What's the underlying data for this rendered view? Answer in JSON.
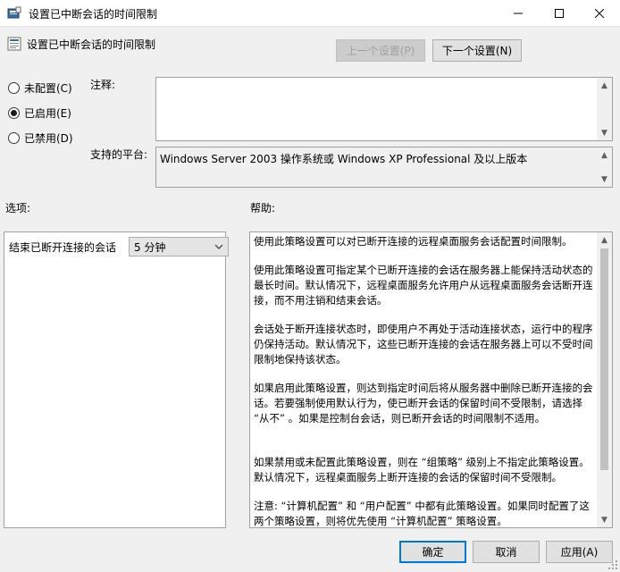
{
  "window": {
    "title": "设置已中断会话的时间限制"
  },
  "header": {
    "title": "设置已中断会话的时间限制",
    "prev_label": "上一个设置(P)",
    "next_label": "下一个设置(N)"
  },
  "state": {
    "options": [
      {
        "label": "未配置(C)",
        "selected": false
      },
      {
        "label": "已启用(E)",
        "selected": true
      },
      {
        "label": "已禁用(D)",
        "selected": false
      }
    ]
  },
  "comment": {
    "label": "注释:",
    "value": ""
  },
  "platform": {
    "label": "支持的平台:",
    "value": "Windows Server 2003 操作系统或 Windows XP Professional 及以上版本"
  },
  "options_section": {
    "label": "选项:",
    "field_label": "结束已断开连接的会话",
    "field_value": "5 分钟"
  },
  "help": {
    "label": "帮助:",
    "paragraphs": [
      "使用此策略设置可以对已断开连接的远程桌面服务会话配置时间限制。",
      "使用此策略设置可指定某个已断开连接的会话在服务器上能保持活动状态的最长时间。默认情况下，远程桌面服务允许用户从远程桌面服务会话断开连接，而不用注销和结束会话。",
      "会话处于断开连接状态时，即使用户不再处于活动连接状态，运行中的程序仍保持活动。默认情况下，这些已断开连接的会话在服务器上可以不受时间限制地保持该状态。",
      "如果启用此策略设置，则达到指定时间后将从服务器中删除已断开连接的会话。若要强制使用默认行为，使已断开会话的保留时间不受限制，请选择 “从不” 。如果是控制台会话，则已断开会话的时间限制不适用。",
      "如果禁用或未配置此策略设置，则在 “组策略” 级别上不指定此策略设置。默认情况下，远程桌面服务上断开连接的会话的保留时间不受限制。",
      "注意: “计算机配置” 和 “用户配置” 中都有此策略设置。如果同时配置了这两个策略设置，则将优先使用 “计算机配置” 策略设置。"
    ]
  },
  "footer": {
    "ok_label": "确定",
    "cancel_label": "取消",
    "apply_label": "应用(A)"
  }
}
